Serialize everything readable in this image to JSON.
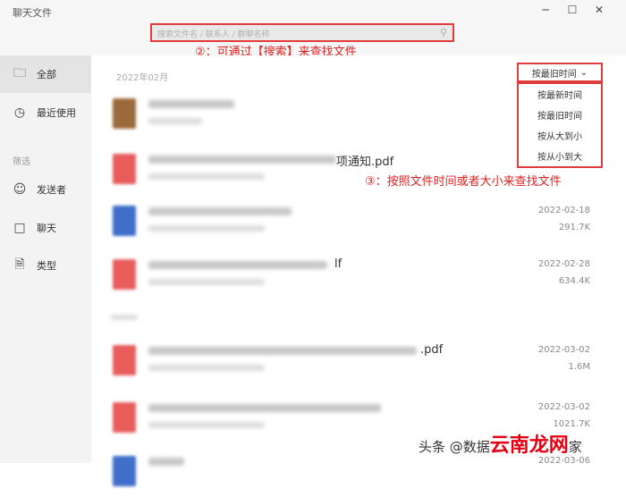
{
  "app": {
    "title": "聊天文件"
  },
  "window_controls": [
    "─",
    "☐",
    "✕"
  ],
  "search": {
    "placeholder": "搜索文件名 / 联系人 / 群聊名称"
  },
  "annotations": {
    "search_note": "②：可通过【搜索】来查找文件",
    "sort_note": "③：按照文件时间或者大小来查找文件"
  },
  "sidebar": {
    "items": [
      {
        "label": "全部",
        "icon": "folder-icon"
      },
      {
        "label": "最近使用",
        "icon": "clock-icon"
      }
    ],
    "filter_title": "筛选",
    "filters": [
      {
        "label": "发送者",
        "icon": "person-icon"
      },
      {
        "label": "聊天",
        "icon": "chat-icon"
      },
      {
        "label": "类型",
        "icon": "document-icon"
      }
    ]
  },
  "main": {
    "date_header": "2022年02月",
    "sort": {
      "selected": "按最旧时间",
      "options": [
        "按最新时间",
        "按最旧时间",
        "按从大到小",
        "按从小到大"
      ]
    },
    "files": [
      {
        "type": "archive",
        "name_visible": "",
        "date": "",
        "size": ""
      },
      {
        "type": "pdf",
        "name_visible": "项通知.pdf",
        "date": "",
        "size": ""
      },
      {
        "type": "doc",
        "name_visible": "",
        "date": "2022-02-18",
        "size": "291.7K"
      },
      {
        "type": "pdf",
        "name_visible": "lf",
        "date": "2022-02-28",
        "size": "634.4K"
      },
      {
        "type": "pdf",
        "name_visible": ".pdf",
        "date": "2022-03-02",
        "size": "1.6M"
      },
      {
        "type": "pdf",
        "name_visible": "",
        "date": "2022-03-02",
        "size": "1021.7K"
      },
      {
        "type": "doc",
        "name_visible": "",
        "date": "2022-03-06",
        "size": ""
      }
    ]
  },
  "watermark": {
    "prefix": "头条 @数据",
    "brand": "云南龙网",
    "suffix": "家"
  },
  "colors": {
    "annotation": "#e23b3b",
    "pdf_icon": "#e85c5c",
    "doc_icon": "#3f6fc9",
    "archive_icon": "#9b6a3a"
  }
}
